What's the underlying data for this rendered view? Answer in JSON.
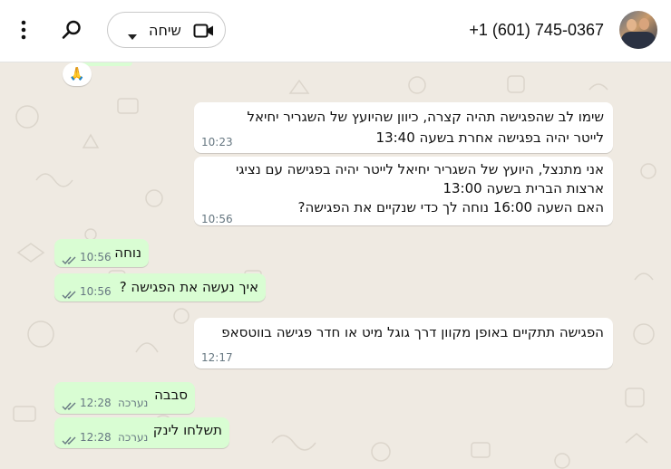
{
  "header": {
    "contact_phone": "+1 (601) 745-0367",
    "call_label": "שיחה",
    "icons": {
      "video": "video-camera-icon",
      "dropdown": "chevron-down-icon",
      "search": "search-icon",
      "more": "more-vertical-icon"
    }
  },
  "chat": {
    "reaction_emoji": "🙏",
    "messages": [
      {
        "direction": "incoming",
        "text": "שימו לב שהפגישה תהיה קצרה, כיוון שהיועץ של השגריר יחיאל\nלייטר יהיה בפגישה אחרת בשעה 13:40",
        "time": "10:23"
      },
      {
        "direction": "incoming",
        "text": "אני מתנצל, היועץ של השגריר יחיאל לייטר יהיה בפגישה עם נציגי\nארצות הברית בשעה 13:00\nהאם השעה 16:00 נוחה לך כדי שנקיים את הפגישה?",
        "time": "10:56"
      },
      {
        "direction": "outgoing",
        "text": "נוחה",
        "time": "10:56",
        "status": "read"
      },
      {
        "direction": "outgoing",
        "text": "איך נעשה את הפגישה ?",
        "time": "10:56",
        "status": "read"
      },
      {
        "direction": "incoming",
        "text": "הפגישה תתקיים באופן מקוון דרך גוגל מיט או חדר פגישה בווטסאפ",
        "time": "12:17"
      },
      {
        "direction": "outgoing",
        "text": "סבבה",
        "time": "12:28",
        "edited_label": "נערכה",
        "status": "read"
      },
      {
        "direction": "outgoing",
        "text": "תשלחו לינק",
        "time": "12:28",
        "edited_label": "נערכה",
        "status": "read"
      }
    ]
  },
  "colors": {
    "incoming_bubble": "#ffffff",
    "outgoing_bubble": "#d9fdd3",
    "chat_background": "#efeae2",
    "read_ticks": "#667781"
  }
}
